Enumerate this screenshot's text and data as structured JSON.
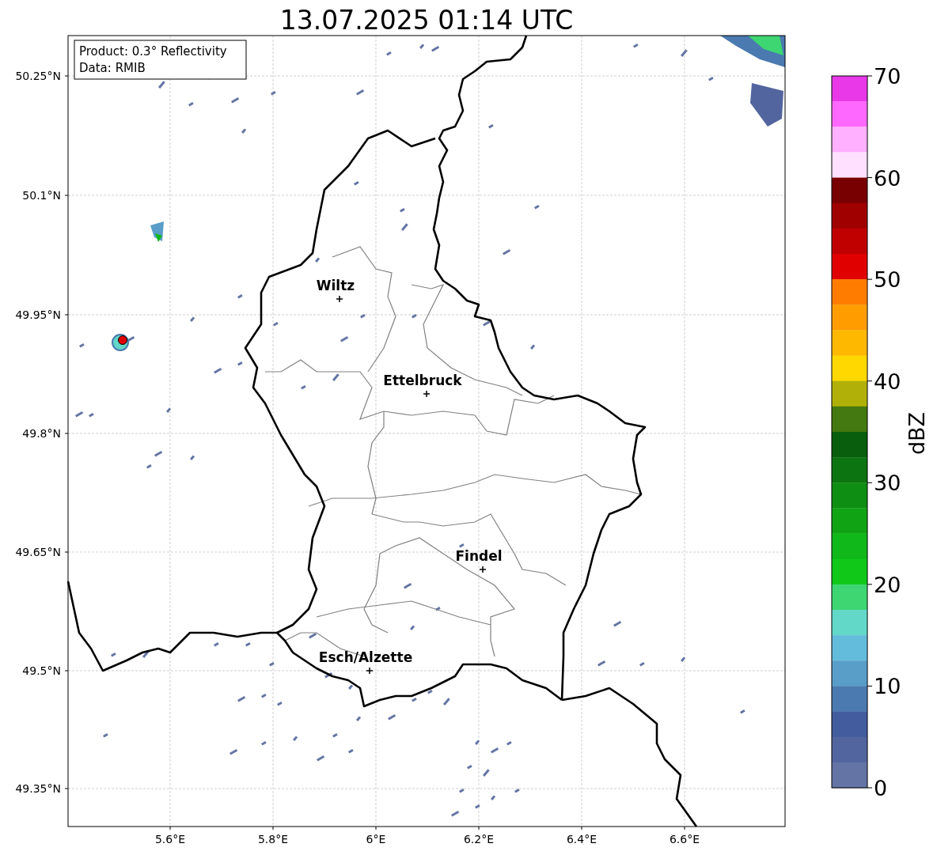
{
  "title": "13.07.2025 01:14 UTC",
  "info_box": [
    "Product: 0.3° Reflectivity",
    "Data: RMIB"
  ],
  "map": {
    "lat_labels": [
      "50.25°N",
      "50.1°N",
      "49.95°N",
      "49.8°N",
      "49.65°N",
      "49.5°N",
      "49.35°N"
    ],
    "lon_labels": [
      "5.6°E",
      "5.8°E",
      "6°E",
      "6.2°E",
      "6.4°E",
      "6.6°E"
    ],
    "cities": [
      {
        "name": "Wiltz"
      },
      {
        "name": "Ettelbruck"
      },
      {
        "name": "Findel"
      },
      {
        "name": "Esch/Alzette"
      }
    ]
  },
  "colorbar": {
    "label": "dBZ",
    "tick_labels": [
      "70",
      "60",
      "50",
      "40",
      "30",
      "20",
      "10",
      "0"
    ],
    "bands": [
      {
        "color": "#e838e8"
      },
      {
        "color": "#ff68ff"
      },
      {
        "color": "#ffb0ff"
      },
      {
        "color": "#ffe0ff"
      },
      {
        "color": "#780000"
      },
      {
        "color": "#a00000"
      },
      {
        "color": "#c00000"
      },
      {
        "color": "#e00000"
      },
      {
        "color": "#ff7c00"
      },
      {
        "color": "#ff9c00"
      },
      {
        "color": "#ffb800"
      },
      {
        "color": "#ffd800"
      },
      {
        "color": "#b0b008"
      },
      {
        "color": "#447810"
      },
      {
        "color": "#085e0c"
      },
      {
        "color": "#0c7410"
      },
      {
        "color": "#0e8e12"
      },
      {
        "color": "#10a414"
      },
      {
        "color": "#10b81a"
      },
      {
        "color": "#10c818"
      },
      {
        "color": "#3ed672"
      },
      {
        "color": "#62d8c8"
      },
      {
        "color": "#64bcdc"
      },
      {
        "color": "#589ec8"
      },
      {
        "color": "#4a7ab0"
      },
      {
        "color": "#435c9e"
      },
      {
        "color": "#52659e"
      },
      {
        "color": "#6474a4"
      }
    ]
  }
}
